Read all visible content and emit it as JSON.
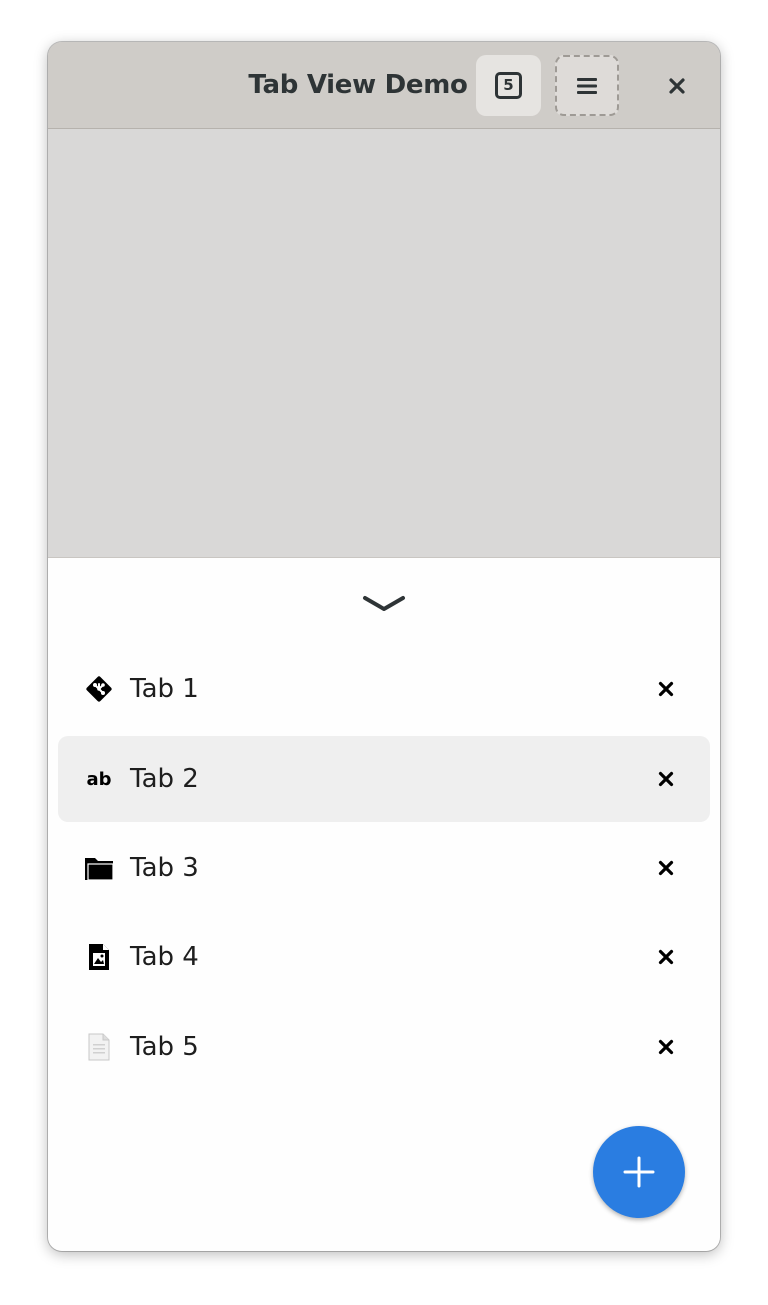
{
  "window": {
    "title": "Tab View Demo",
    "tab_count": "5"
  },
  "tabs": [
    {
      "label": "Tab 1",
      "icon": "git-icon"
    },
    {
      "label": "Tab 2",
      "icon": "text-ab-icon",
      "selected": true
    },
    {
      "label": "Tab 3",
      "icon": "folder-icon"
    },
    {
      "label": "Tab 4",
      "icon": "image-document-icon"
    },
    {
      "label": "Tab 5",
      "icon": "text-document-icon"
    }
  ],
  "icons": {
    "tabs_overview": "tab-counter-icon",
    "menu": "hamburger-menu-icon",
    "close_window": "close-icon",
    "collapse": "chevron-down-icon",
    "tab_close": "close-icon",
    "new_tab": "plus-icon"
  },
  "colors": {
    "accent": "#2a7de1",
    "headerbar": "#cfccc8",
    "content": "#d9d8d7",
    "selected_row": "#efefef"
  }
}
